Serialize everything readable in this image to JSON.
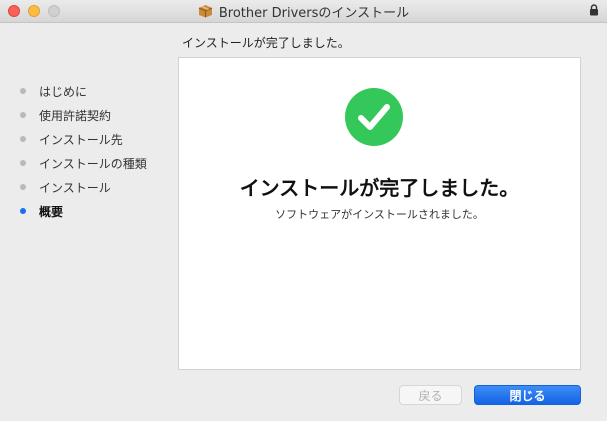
{
  "window": {
    "title": "Brother Driversのインストール"
  },
  "header": {
    "heading": "インストールが完了しました。"
  },
  "sidebar": {
    "items": [
      {
        "label": "はじめに",
        "active": false
      },
      {
        "label": "使用許諾契約",
        "active": false
      },
      {
        "label": "インストール先",
        "active": false
      },
      {
        "label": "インストールの種類",
        "active": false
      },
      {
        "label": "インストール",
        "active": false
      },
      {
        "label": "概要",
        "active": true
      }
    ]
  },
  "main": {
    "title": "インストールが完了しました。",
    "subtitle": "ソフトウェアがインストールされました。",
    "status_icon": "check-circle-icon"
  },
  "buttons": {
    "back_label": "戻る",
    "close_label": "閉じる"
  },
  "colors": {
    "accent": "#1d6df0",
    "success": "#34c759"
  }
}
